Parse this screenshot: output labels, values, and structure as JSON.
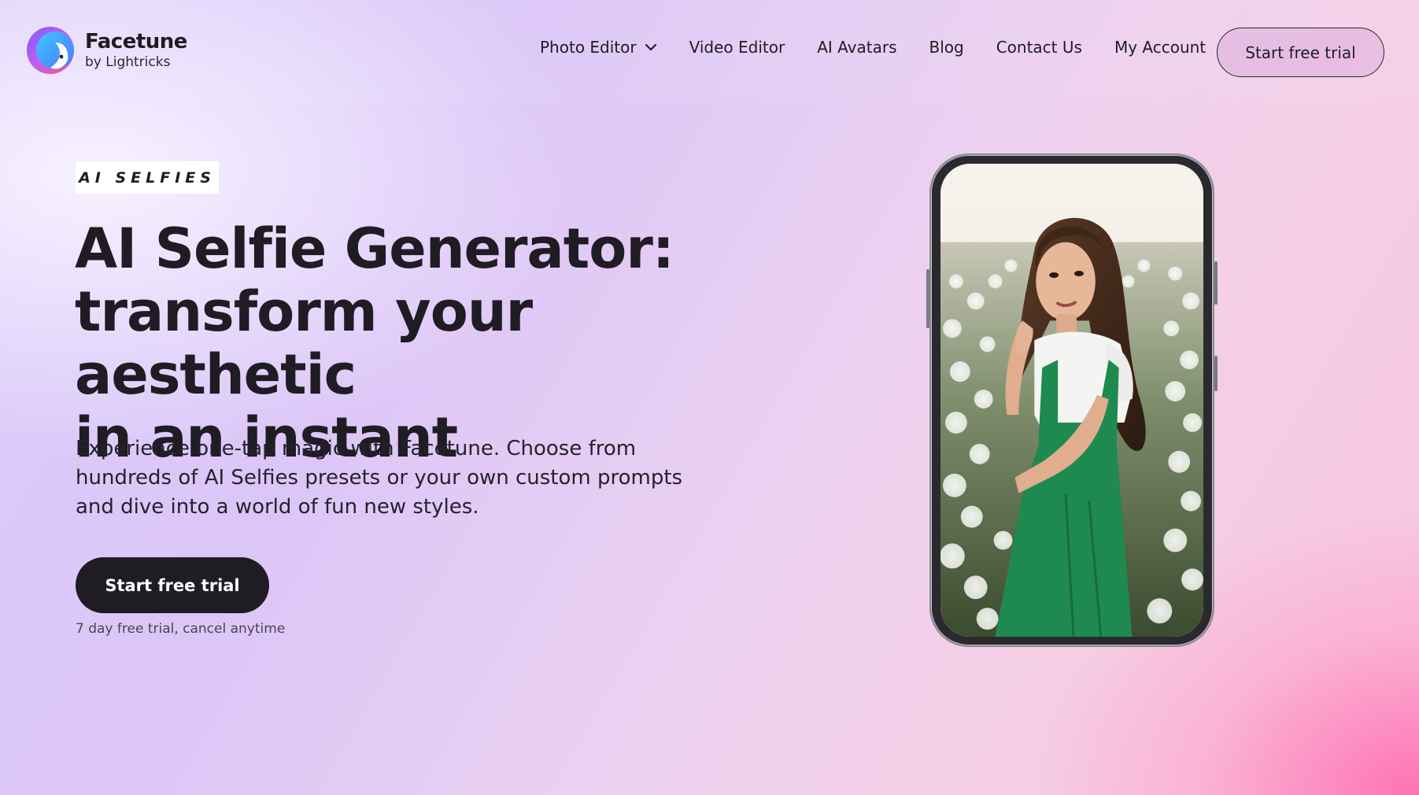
{
  "brand": {
    "name": "Facetune",
    "sub": "by Lightricks"
  },
  "nav": {
    "items": [
      "Photo Editor",
      "Video Editor",
      "AI Avatars",
      "Blog",
      "Contact Us",
      "My Account"
    ],
    "cta_label": "Start free trial"
  },
  "hero": {
    "eyebrow": "AI SELFIES",
    "title_lines": [
      "AI Selfie Generator:",
      "transform your aesthetic",
      "in an instant"
    ],
    "description": "Experience one-tap magic with Facetune. Choose from hundreds of AI Selfies presets or your own custom prompts and dive into a world of fun new styles.",
    "cta_label": "Start free trial",
    "cta_note": "7 day free trial, cancel anytime"
  },
  "colors": {
    "text": "#1f1c24",
    "button_dark": "#1f1c24",
    "bg_lavender": "#d9ccfb",
    "bg_pink": "#ff6eaf"
  },
  "icons": {
    "dropdown": "chevron-down-icon",
    "logo": "facetune-logo-icon"
  }
}
